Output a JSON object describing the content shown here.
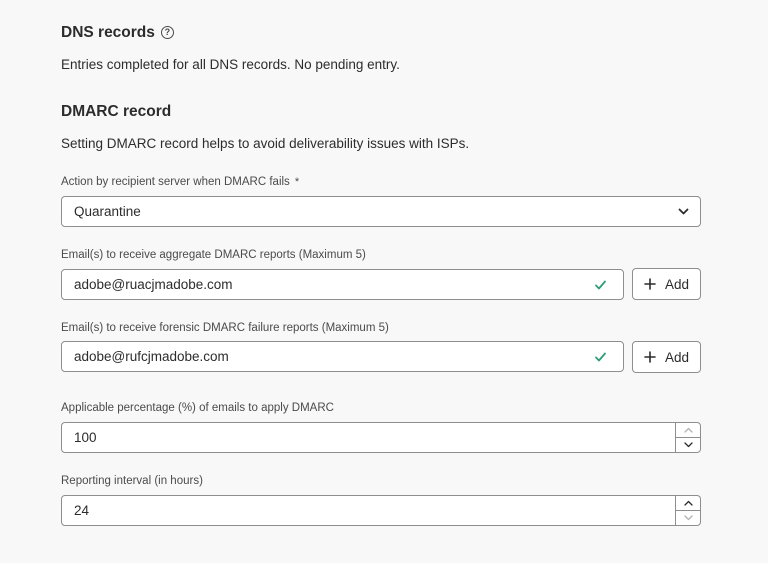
{
  "dns": {
    "title": "DNS records",
    "help_icon": "help-circle-icon",
    "status_text": "Entries completed for all DNS records. No pending entry."
  },
  "dmarc": {
    "title": "DMARC record",
    "description": "Setting DMARC record helps to avoid deliverability issues with ISPs.",
    "action": {
      "label": "Action by recipient server when DMARC fails",
      "required_marker": "*",
      "value": "Quarantine"
    },
    "aggregate": {
      "label": "Email(s) to receive aggregate DMARC reports (Maximum 5)",
      "value": "adobe@ruacjmadobe.com",
      "add_label": "Add"
    },
    "forensic": {
      "label": "Email(s) to receive forensic DMARC failure reports (Maximum 5)",
      "value": "adobe@rufcjmadobe.com",
      "add_label": "Add"
    },
    "percentage": {
      "label": "Applicable percentage (%) of emails to apply DMARC",
      "value": "100"
    },
    "interval": {
      "label": "Reporting interval (in hours)",
      "value": "24"
    }
  },
  "colors": {
    "valid_check": "#2d9d78",
    "border": "#8e8e8e",
    "background": "#f8f8f8",
    "text": "#2c2c2c"
  }
}
